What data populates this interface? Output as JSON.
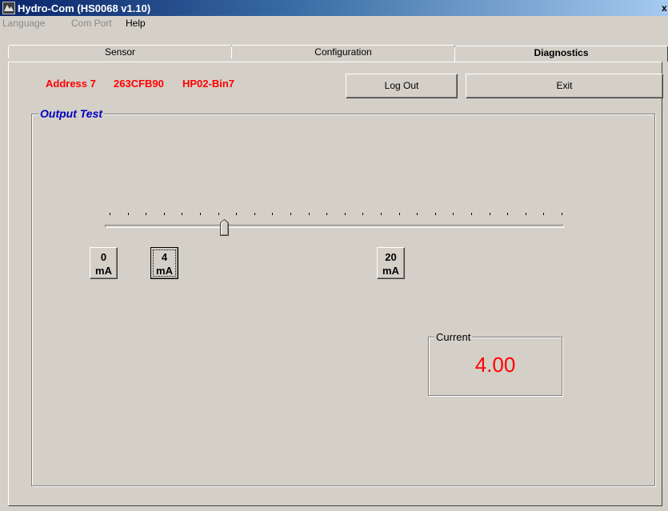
{
  "window": {
    "title": "Hydro-Com (HS0068 v1.10)",
    "close_symbol": "x"
  },
  "menu": [
    {
      "label": "Language",
      "enabled": false
    },
    {
      "label": "Com Port",
      "enabled": false
    },
    {
      "label": "Help",
      "enabled": true
    }
  ],
  "tabs": [
    {
      "label": "Sensor",
      "active": false
    },
    {
      "label": "Configuration",
      "active": false
    },
    {
      "label": "Diagnostics",
      "active": true
    }
  ],
  "device": {
    "address": "Address 7",
    "serial": "263CFB90",
    "name": "HP02-Bin7",
    "color": "#ff0000"
  },
  "buttons": {
    "logout": "Log Out",
    "exit": "Exit"
  },
  "output_test": {
    "title": "Output Test",
    "title_color": "#0000c0",
    "slider": {
      "min_ma": 0,
      "max_ma": 20,
      "value_ma": 4,
      "tick_count": 26
    },
    "presets": [
      {
        "line1": "0",
        "line2": "mA"
      },
      {
        "line1": "4",
        "line2": "mA"
      },
      {
        "line1": "20",
        "line2": "mA"
      }
    ],
    "current": {
      "label": "Current",
      "value": "4.00",
      "color": "#ff0000"
    }
  }
}
